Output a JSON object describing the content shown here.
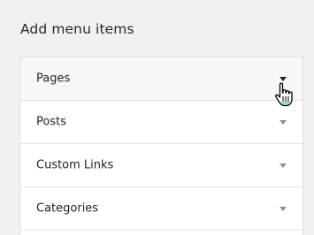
{
  "panel": {
    "title": "Add menu items"
  },
  "accordion": {
    "items": [
      {
        "label": "Pages",
        "icon": "chevron-down-icon"
      },
      {
        "label": "Posts",
        "icon": "chevron-down-icon"
      },
      {
        "label": "Custom Links",
        "icon": "chevron-down-icon"
      },
      {
        "label": "Categories",
        "icon": "chevron-down-icon"
      }
    ]
  },
  "colors": {
    "background": "#f1f1f1",
    "panel": "#ffffff",
    "active_row": "#f6f7f7",
    "arrow": "#8c8f94",
    "cursor_fill": "#ffffff"
  }
}
